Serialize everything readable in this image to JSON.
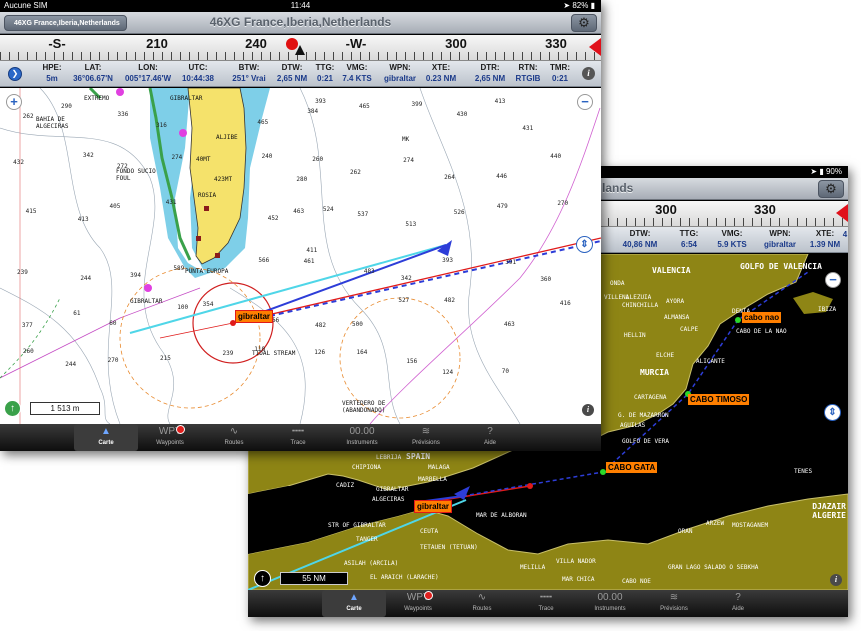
{
  "front": {
    "status": {
      "carrier": "Aucune SIM",
      "time": "11:44",
      "battery": "82%"
    },
    "nav": {
      "back_label": "46XG France,Iberia,Netherlands",
      "title": "46XG France,Iberia,Netherlands"
    },
    "compass": {
      "labels": [
        "-S-",
        "210",
        "240",
        "-W-",
        "300",
        "330"
      ]
    },
    "instruments": [
      {
        "label": "HPE:",
        "value": "5m"
      },
      {
        "label": "LAT:",
        "value": "36°06.67'N"
      },
      {
        "label": "LON:",
        "value": "005°17.46'W"
      },
      {
        "label": "UTC:",
        "value": "10:44:38"
      },
      {
        "label": "BTW:",
        "value": "251° Vrai"
      },
      {
        "label": "DTW:",
        "value": "2,65 NM"
      },
      {
        "label": "TTG:",
        "value": "0:21"
      },
      {
        "label": "VMG:",
        "value": "7.4 KTS"
      },
      {
        "label": "WPN:",
        "value": "gibraltar"
      },
      {
        "label": "XTE:",
        "value": "0.23 NM"
      },
      {
        "label": "DTR:",
        "value": "2,65 NM"
      },
      {
        "label": "RTN:",
        "value": "RTGIB"
      },
      {
        "label": "TMR:",
        "value": "0:21"
      }
    ],
    "map": {
      "scale": "1 513 m",
      "waypoint": "gibraltar",
      "places": [
        "EXTREMO",
        "BAHIA DE ALGECIRAS",
        "GIBRALTAR",
        "ALJIBE",
        "FONDO SUCIO FOUL",
        "ROSIA",
        "423MT",
        "PUNTA EUROPA",
        "TIDAL STREAM",
        "VERTEDERO DE (ABANDONADO)",
        "40MT"
      ],
      "soundings": [
        "262",
        "290",
        "336",
        "316",
        "384",
        "465",
        "393",
        "465",
        "399",
        "430",
        "413",
        "431",
        "432",
        "342",
        "272",
        "274",
        "280",
        "240",
        "260",
        "262",
        "274",
        "264",
        "446",
        "440",
        "415",
        "413",
        "405",
        "431",
        "463",
        "452",
        "524",
        "537",
        "513",
        "526",
        "479",
        "270",
        "239",
        "244",
        "394",
        "589",
        "411",
        "566",
        "461",
        "483",
        "342",
        "393",
        "391",
        "360",
        "377",
        "61",
        "60",
        "100",
        "354",
        "456",
        "482",
        "500",
        "527",
        "482",
        "463",
        "416",
        "260",
        "244",
        "270",
        "215",
        "239",
        "110",
        "126",
        "164",
        "156",
        "124",
        "70"
      ],
      "compass_note": "MK"
    },
    "tabs": [
      {
        "label": "Carte",
        "icon": "▲"
      },
      {
        "label": "Waypoints",
        "icon": "WPT"
      },
      {
        "label": "Routes",
        "icon": "∿"
      },
      {
        "label": "Trace",
        "icon": "╍╍"
      },
      {
        "label": "Instruments",
        "icon": "00.00"
      },
      {
        "label": "Prévisions",
        "icon": "≋"
      },
      {
        "label": "Aide",
        "icon": "?"
      }
    ]
  },
  "back": {
    "status": {
      "battery": "90%"
    },
    "nav": {
      "title": "lands"
    },
    "compass": {
      "labels": [
        "300",
        "330"
      ]
    },
    "instruments": [
      {
        "label": "DTW:",
        "value": "40,86 NM"
      },
      {
        "label": "TTG:",
        "value": "6:54"
      },
      {
        "label": "VMG:",
        "value": "5.9 KTS"
      },
      {
        "label": "WPN:",
        "value": "gibraltar"
      },
      {
        "label": "XTE:",
        "value": "1.39 NM"
      },
      {
        "label": "",
        "value": "4"
      }
    ],
    "map": {
      "scale": "55 NM",
      "waypoints": [
        "cabo nao",
        "CABO TIMOSO",
        "CABO GATA",
        "gibraltar"
      ],
      "regions": [
        "VALENCIA",
        "GOLFO DE VALENCIA",
        "MURCIA",
        "SPAIN",
        "DJAZAIR ALGERIE"
      ],
      "places": [
        "IBIZA",
        "DENIA",
        "CABO DE LA NAO",
        "ONDA",
        "VILLENA",
        "LLEZUIA",
        "CHINCHILLA",
        "AYORA",
        "ALMANSA",
        "CALPE",
        "HELLIN",
        "ELCHE",
        "ALICANTE",
        "CARTAGENA",
        "G. DE MAZARRON",
        "AGUILAS",
        "GOLFO DE VERA",
        "MALAGA",
        "MARBELLA",
        "CHIPIONA",
        "CADIZ",
        "ALGECIRAS",
        "MAR DE ALBORAN",
        "STR OF GIBRALTAR",
        "TANGER",
        "CEUTA",
        "TETAUEN (TETUAN)",
        "ASILAH (ARCILA)",
        "EL ARAICH (LARACHE)",
        "MELILLA",
        "VILLA NADOR",
        "MAR CHICA",
        "GRAN LAGO SALADO O SEBKHA",
        "CABO NOE",
        "ORAN",
        "ARZEW",
        "MOSTAGANEM",
        "TENES",
        "LEBRIJA",
        "GIBRALTAR"
      ]
    },
    "tabs": [
      {
        "label": "Carte",
        "icon": "▲"
      },
      {
        "label": "Waypoints",
        "icon": "WPT"
      },
      {
        "label": "Routes",
        "icon": "∿"
      },
      {
        "label": "Trace",
        "icon": "╍╍"
      },
      {
        "label": "Instruments",
        "icon": "00.00"
      },
      {
        "label": "Prévisions",
        "icon": "≋"
      },
      {
        "label": "Aide",
        "icon": "?"
      }
    ]
  },
  "colors": {
    "land_front": "#f5e26b",
    "shallow_front": "#7ecfe8",
    "sea_front": "#ffffff",
    "land_back": "#8e8515",
    "sea_back": "#000000",
    "route_red": "#e01a1a",
    "cyan_track": "#4fd6e8",
    "wp_orange": "#ff7f00"
  }
}
